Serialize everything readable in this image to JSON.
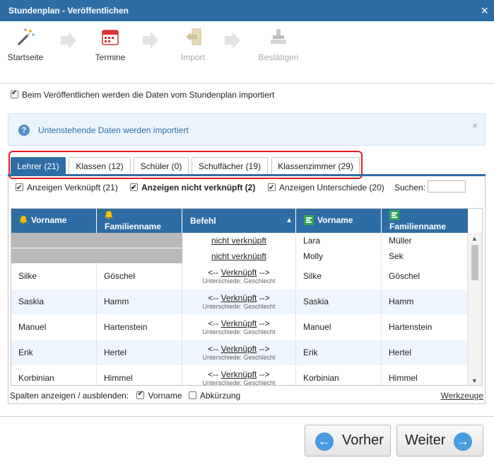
{
  "window": {
    "title": "Stundenplan - Veröffentlichen",
    "close_glyph": "×"
  },
  "wizard": {
    "steps": [
      {
        "label": "Startseite",
        "icon": "magic-wand-icon",
        "enabled": true
      },
      {
        "label": "Termine",
        "icon": "calendar-icon",
        "enabled": true
      },
      {
        "label": "Import",
        "icon": "import-arrow-icon",
        "enabled": false,
        "current": true
      },
      {
        "label": "Bestätigen",
        "icon": "stamp-icon",
        "enabled": false
      }
    ]
  },
  "import_option": {
    "label": "Beim Veröffentlichen werden die Daten vom Stundenplan importiert",
    "checked": true
  },
  "info": {
    "icon": "question-icon",
    "message": "Untenstehende Daten werden importiert",
    "close_glyph": "×"
  },
  "tabs": [
    {
      "label": "Lehrer (21)",
      "active": true
    },
    {
      "label": "Klassen (12)",
      "active": false
    },
    {
      "label": "Schüler (0)",
      "active": false
    },
    {
      "label": "Schulfächer (19)",
      "active": false
    },
    {
      "label": "Klassenzimmer (29)",
      "active": false
    }
  ],
  "filters": {
    "linked": {
      "label": "Anzeigen Verknüpft (21)",
      "checked": true
    },
    "unlinked": {
      "label": "Anzeigen nicht verknüpft (2)",
      "checked": true
    },
    "diffs": {
      "label": "Anzeigen Unterschiede (20)",
      "checked": true
    },
    "search_label": "Suchen:",
    "search_value": ""
  },
  "grid": {
    "headers": {
      "left_first": "Vorname",
      "left_last": "Familienname",
      "command": "Befehl",
      "sort_indicator": "▲",
      "right_first": "Vorname",
      "right_last": "Familienname"
    },
    "rows": [
      {
        "left_first": "",
        "left_last": "",
        "command": "nicht verknüpft",
        "diff": "",
        "right_first": "Lara",
        "right_last": "Müller",
        "unlinked": true
      },
      {
        "left_first": "",
        "left_last": "",
        "command": "nicht verknüpft",
        "diff": "",
        "right_first": "Molly",
        "right_last": "Sek",
        "unlinked": true
      },
      {
        "left_first": "Silke",
        "left_last": "Göschel",
        "command": "Verknüpft",
        "diff": "Unterschiede: Geschlecht",
        "right_first": "Silke",
        "right_last": "Göschel"
      },
      {
        "left_first": "Saskia",
        "left_last": "Hamm",
        "command": "Verknüpft",
        "diff": "Unterschiede: Geschlecht",
        "right_first": "Saskia",
        "right_last": "Hamm"
      },
      {
        "left_first": "Manuel",
        "left_last": "Hartenstein",
        "command": "Verknüpft",
        "diff": "Unterschiede: Geschlecht",
        "right_first": "Manuel",
        "right_last": "Hartenstein"
      },
      {
        "left_first": "Erik",
        "left_last": "Hertel",
        "command": "Verknüpft",
        "diff": "Unterschiede: Geschlecht",
        "right_first": "Erik",
        "right_last": "Hertel"
      },
      {
        "left_first": "Korbinian",
        "left_last": "Himmel",
        "command": "Verknüpft",
        "diff": "Unterschiede: Geschlecht",
        "right_first": "Korbinian",
        "right_last": "Himmel"
      }
    ],
    "link_prefix": "<--",
    "link_suffix": "-->"
  },
  "columns_bar": {
    "label": "Spalten anzeigen / ausblenden:",
    "first_name": {
      "label": "Vorname",
      "checked": true
    },
    "abbrev": {
      "label": "Abkürzung",
      "checked": false
    },
    "tools_label": "Werkzeuge"
  },
  "footer": {
    "prev_label": "Vorher",
    "next_label": "Weiter"
  },
  "colors": {
    "primary": "#2e6da4",
    "highlight": "#e02020",
    "info_text": "#2f6fa8",
    "button_icon": "#4a9be0"
  }
}
